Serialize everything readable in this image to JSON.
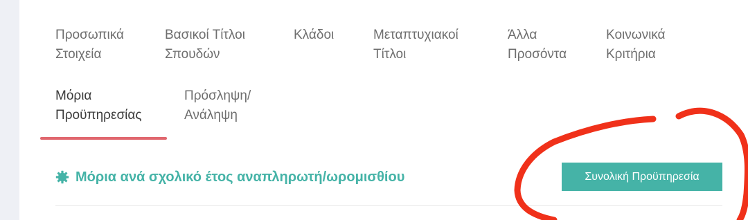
{
  "tabs": [
    {
      "label": "Προσωπικά\nΣτοιχεία"
    },
    {
      "label": "Βασικοί Τίτλοι\nΣπουδών"
    },
    {
      "label": "Κλάδοι"
    },
    {
      "label": "Μεταπτυχιακοί\nΤίτλοι"
    },
    {
      "label": "Άλλα\nΠροσόντα"
    },
    {
      "label": "Κοινωνικά\nΚριτήρια"
    },
    {
      "label": "Μόρια\nΠροϋπηρεσίας",
      "active": true
    },
    {
      "label": "Πρόσληψη/\nΑνάληψη"
    }
  ],
  "section": {
    "icon": "gear-icon",
    "title": "Μόρια ανά σχολικό έτος αναπληρωτή/ωρομισθίου"
  },
  "actions": {
    "total_service_label": "Συνολική Προϋπηρεσία"
  },
  "colors": {
    "accent": "#45b3a7",
    "active_underline": "#e0676e",
    "annotation": "#f0311a"
  }
}
